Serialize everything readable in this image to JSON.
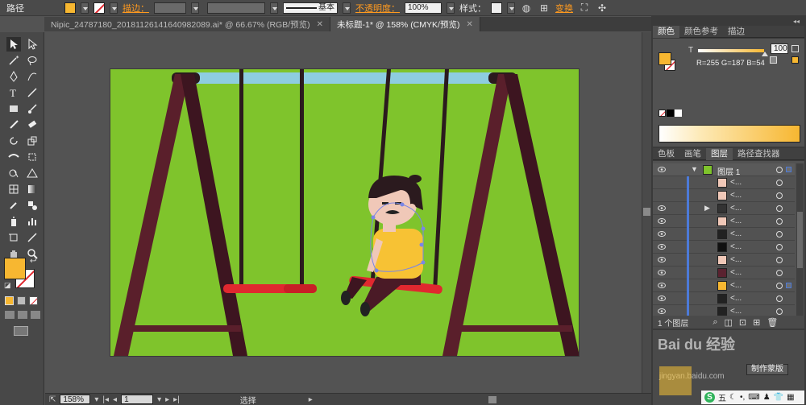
{
  "control_bar": {
    "mode_label": "路径",
    "stroke_label": "描边：",
    "stroke_profile": "基本",
    "opacity_label": "不透明度：",
    "opacity_value": "100%",
    "style_label": "样式：",
    "transform_label": "变换",
    "fill_color": "#f7b731"
  },
  "tabs": [
    {
      "label": "Nipic_24787180_20181126141640982089.ai* @ 66.67% (RGB/预览)",
      "close": "✕"
    },
    {
      "label": "未标题-1* @ 158% (CMYK/预览)",
      "close": "✕"
    }
  ],
  "tools": {
    "fill_color": "#f7b731",
    "stroke_color": "#ffffff"
  },
  "color_panel": {
    "tabs": [
      "颜色",
      "颜色参考",
      "描边"
    ],
    "tint_label": "T",
    "tint_value": "100",
    "rgb_readout": "R=255 G=187 B=54",
    "fill_color": "#f7b731"
  },
  "layers_panel": {
    "tabs": [
      "色板",
      "画笔",
      "图层",
      "路径查找器"
    ],
    "layer_name": "图层 1",
    "sublayer_name": "<...",
    "layer_count": "1 个图层",
    "rows": [
      {
        "name": "<...",
        "thumb": "#f0c8b8"
      },
      {
        "name": "<...",
        "thumb": "#f0c8b8"
      },
      {
        "name": "<...",
        "thumb": "#333333"
      },
      {
        "name": "<...",
        "thumb": "#f0c8b8"
      },
      {
        "name": "<...",
        "thumb": "#222222"
      },
      {
        "name": "<...",
        "thumb": "#111111"
      },
      {
        "name": "<...",
        "thumb": "#f0c8b8"
      },
      {
        "name": "<...",
        "thumb": "#5a2230"
      },
      {
        "name": "<...",
        "thumb": "#f7b731"
      },
      {
        "name": "<...",
        "thumb": "#222222"
      },
      {
        "name": "<...",
        "thumb": "#222222"
      }
    ]
  },
  "bottom_panel": {
    "make_mask_label": "制作蒙版",
    "watermark": "Bai du 经验",
    "watermark_sub": "jingyan.baidu.com"
  },
  "status_bar": {
    "zoom": "158%",
    "page": "1",
    "tool": "选择"
  },
  "artboard": {
    "background": "#7fc42c",
    "frame_color": "#5a1f2b",
    "seat_color": "#e0282f",
    "rope_color": "#2b1a1e",
    "crossbar_color": "#8ecde0"
  }
}
